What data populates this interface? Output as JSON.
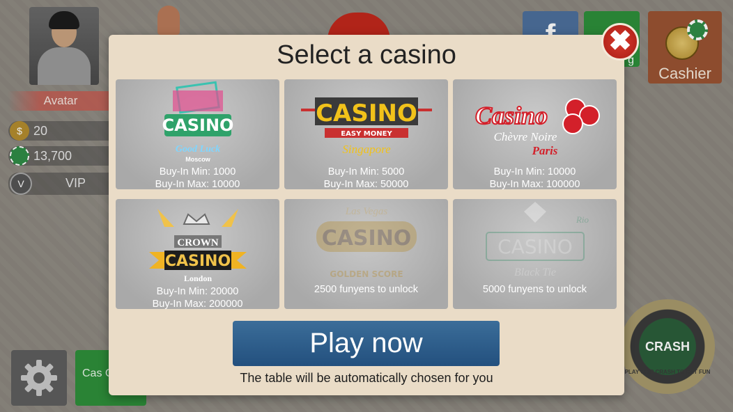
{
  "hud": {
    "avatar_label": "Avatar",
    "coins": "20",
    "chips": "13,700",
    "vip": "VIP",
    "coin_icon": "coin-dollar-icon",
    "chip_icon": "poker-chip-icon",
    "vip_icon": "vip-shield-icon",
    "settings_icon": "gear-icon",
    "cash_collect_label": "Cas Colle",
    "cup_label": "g",
    "cashier_label": "Cashier",
    "fb_label": "f",
    "crash_label": "CRASH",
    "crash_ring": "PLAY CHIP CRASH TO GET FUN"
  },
  "modal": {
    "title": "Select a casino",
    "close_label": "✖",
    "casinos": [
      {
        "name": "CASINO",
        "tagline": "Good Luck",
        "city": "Moscow",
        "min": "Buy-In Min: 1000",
        "max": "Buy-In Max:  10000"
      },
      {
        "name": "CASINO",
        "tagline": "EASY MONEY",
        "city": "Singapore",
        "min": "Buy-In Min: 5000",
        "max": "Buy-In Max:  50000"
      },
      {
        "name": "Casino",
        "tagline": "Chèvre Noire",
        "city": "Paris",
        "min": "Buy-In Min: 10000",
        "max": "Buy-In Max:  100000"
      },
      {
        "name": "CASINO",
        "tagline": "CROWN",
        "city": "London",
        "min": "Buy-In Min: 20000",
        "max": "Buy-In Max:  200000"
      },
      {
        "name": "CASINO",
        "tagline": "Las Vegas",
        "city": "GOLDEN SCORE",
        "lock": "2500 funyens to unlock"
      },
      {
        "name": "CASINO",
        "tagline": "Black Tie",
        "city": "Rio",
        "lock": "5000 funyens to unlock"
      }
    ],
    "play_label": "Play now",
    "play_note": "The table will be automatically chosen for you"
  },
  "colors": {
    "modal_bg": "#eadcc7",
    "play": "#2f5f8c",
    "close": "#c8281c",
    "cashier": "#9a5332",
    "green": "#2e8f3a"
  }
}
